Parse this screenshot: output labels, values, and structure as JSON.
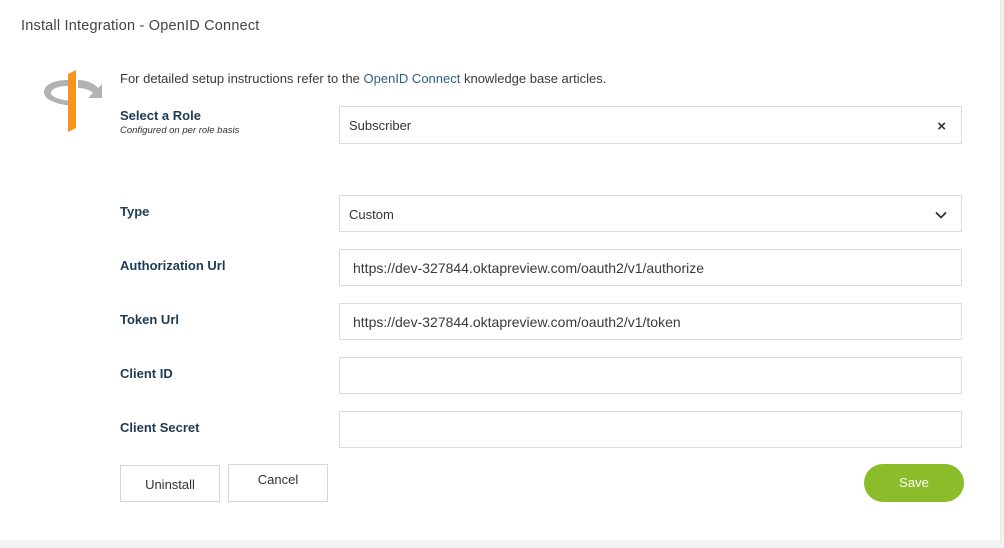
{
  "header": {
    "title": "Install Integration - OpenID Connect"
  },
  "intro": {
    "prefix": "For detailed setup instructions refer to the ",
    "link_text": "OpenID Connect",
    "suffix": " knowledge base articles."
  },
  "form": {
    "role": {
      "label": "Select a Role",
      "sublabel": "Configured on per role basis",
      "value": "Subscriber",
      "clear_icon": "×"
    },
    "type": {
      "label": "Type",
      "value": "Custom"
    },
    "authorization_url": {
      "label": "Authorization Url",
      "value": "https://dev-327844.oktapreview.com/oauth2/v1/authorize"
    },
    "token_url": {
      "label": "Token Url",
      "value": "https://dev-327844.oktapreview.com/oauth2/v1/token"
    },
    "client_id": {
      "label": "Client ID",
      "value": ""
    },
    "client_secret": {
      "label": "Client Secret",
      "value": ""
    }
  },
  "buttons": {
    "uninstall": "Uninstall",
    "cancel": "Cancel",
    "save": "Save"
  },
  "icons": {
    "logo": "openid-logo-icon",
    "chevron": "chevron-down-icon",
    "clear": "close-icon"
  },
  "colors": {
    "accent": "#8bbd2a",
    "label": "#1f3b54",
    "link": "#2b5f8a",
    "logo_orange": "#f7931e",
    "logo_gray": "#b2b2b2"
  }
}
